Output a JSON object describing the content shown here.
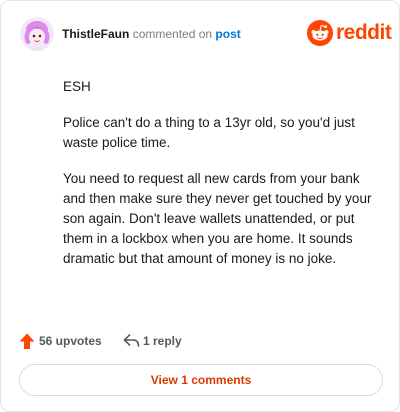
{
  "comment": {
    "author": "ThistleFaun",
    "action_text": "commented on",
    "post_link": "post",
    "body": [
      "ESH",
      "Police can't do a thing to a 13yr old, so you'd just waste police time.",
      "You need to request all new cards from your bank and then make sure they never get touched by your son again. Don't leave wallets unattended, or put them in a lockbox when you are home. It sounds dramatic but that amount of money is no joke."
    ],
    "upvotes_label": "56 upvotes",
    "replies_label": "1 reply",
    "view_comments_label": "View 1 comments"
  },
  "brand": {
    "wordmark": "reddit",
    "icon": "reddit-snoo-icon",
    "color": "#ff4500"
  },
  "colors": {
    "upvote": "#ff4500",
    "link": "#0079d3",
    "view_button_text": "#d93a00"
  }
}
